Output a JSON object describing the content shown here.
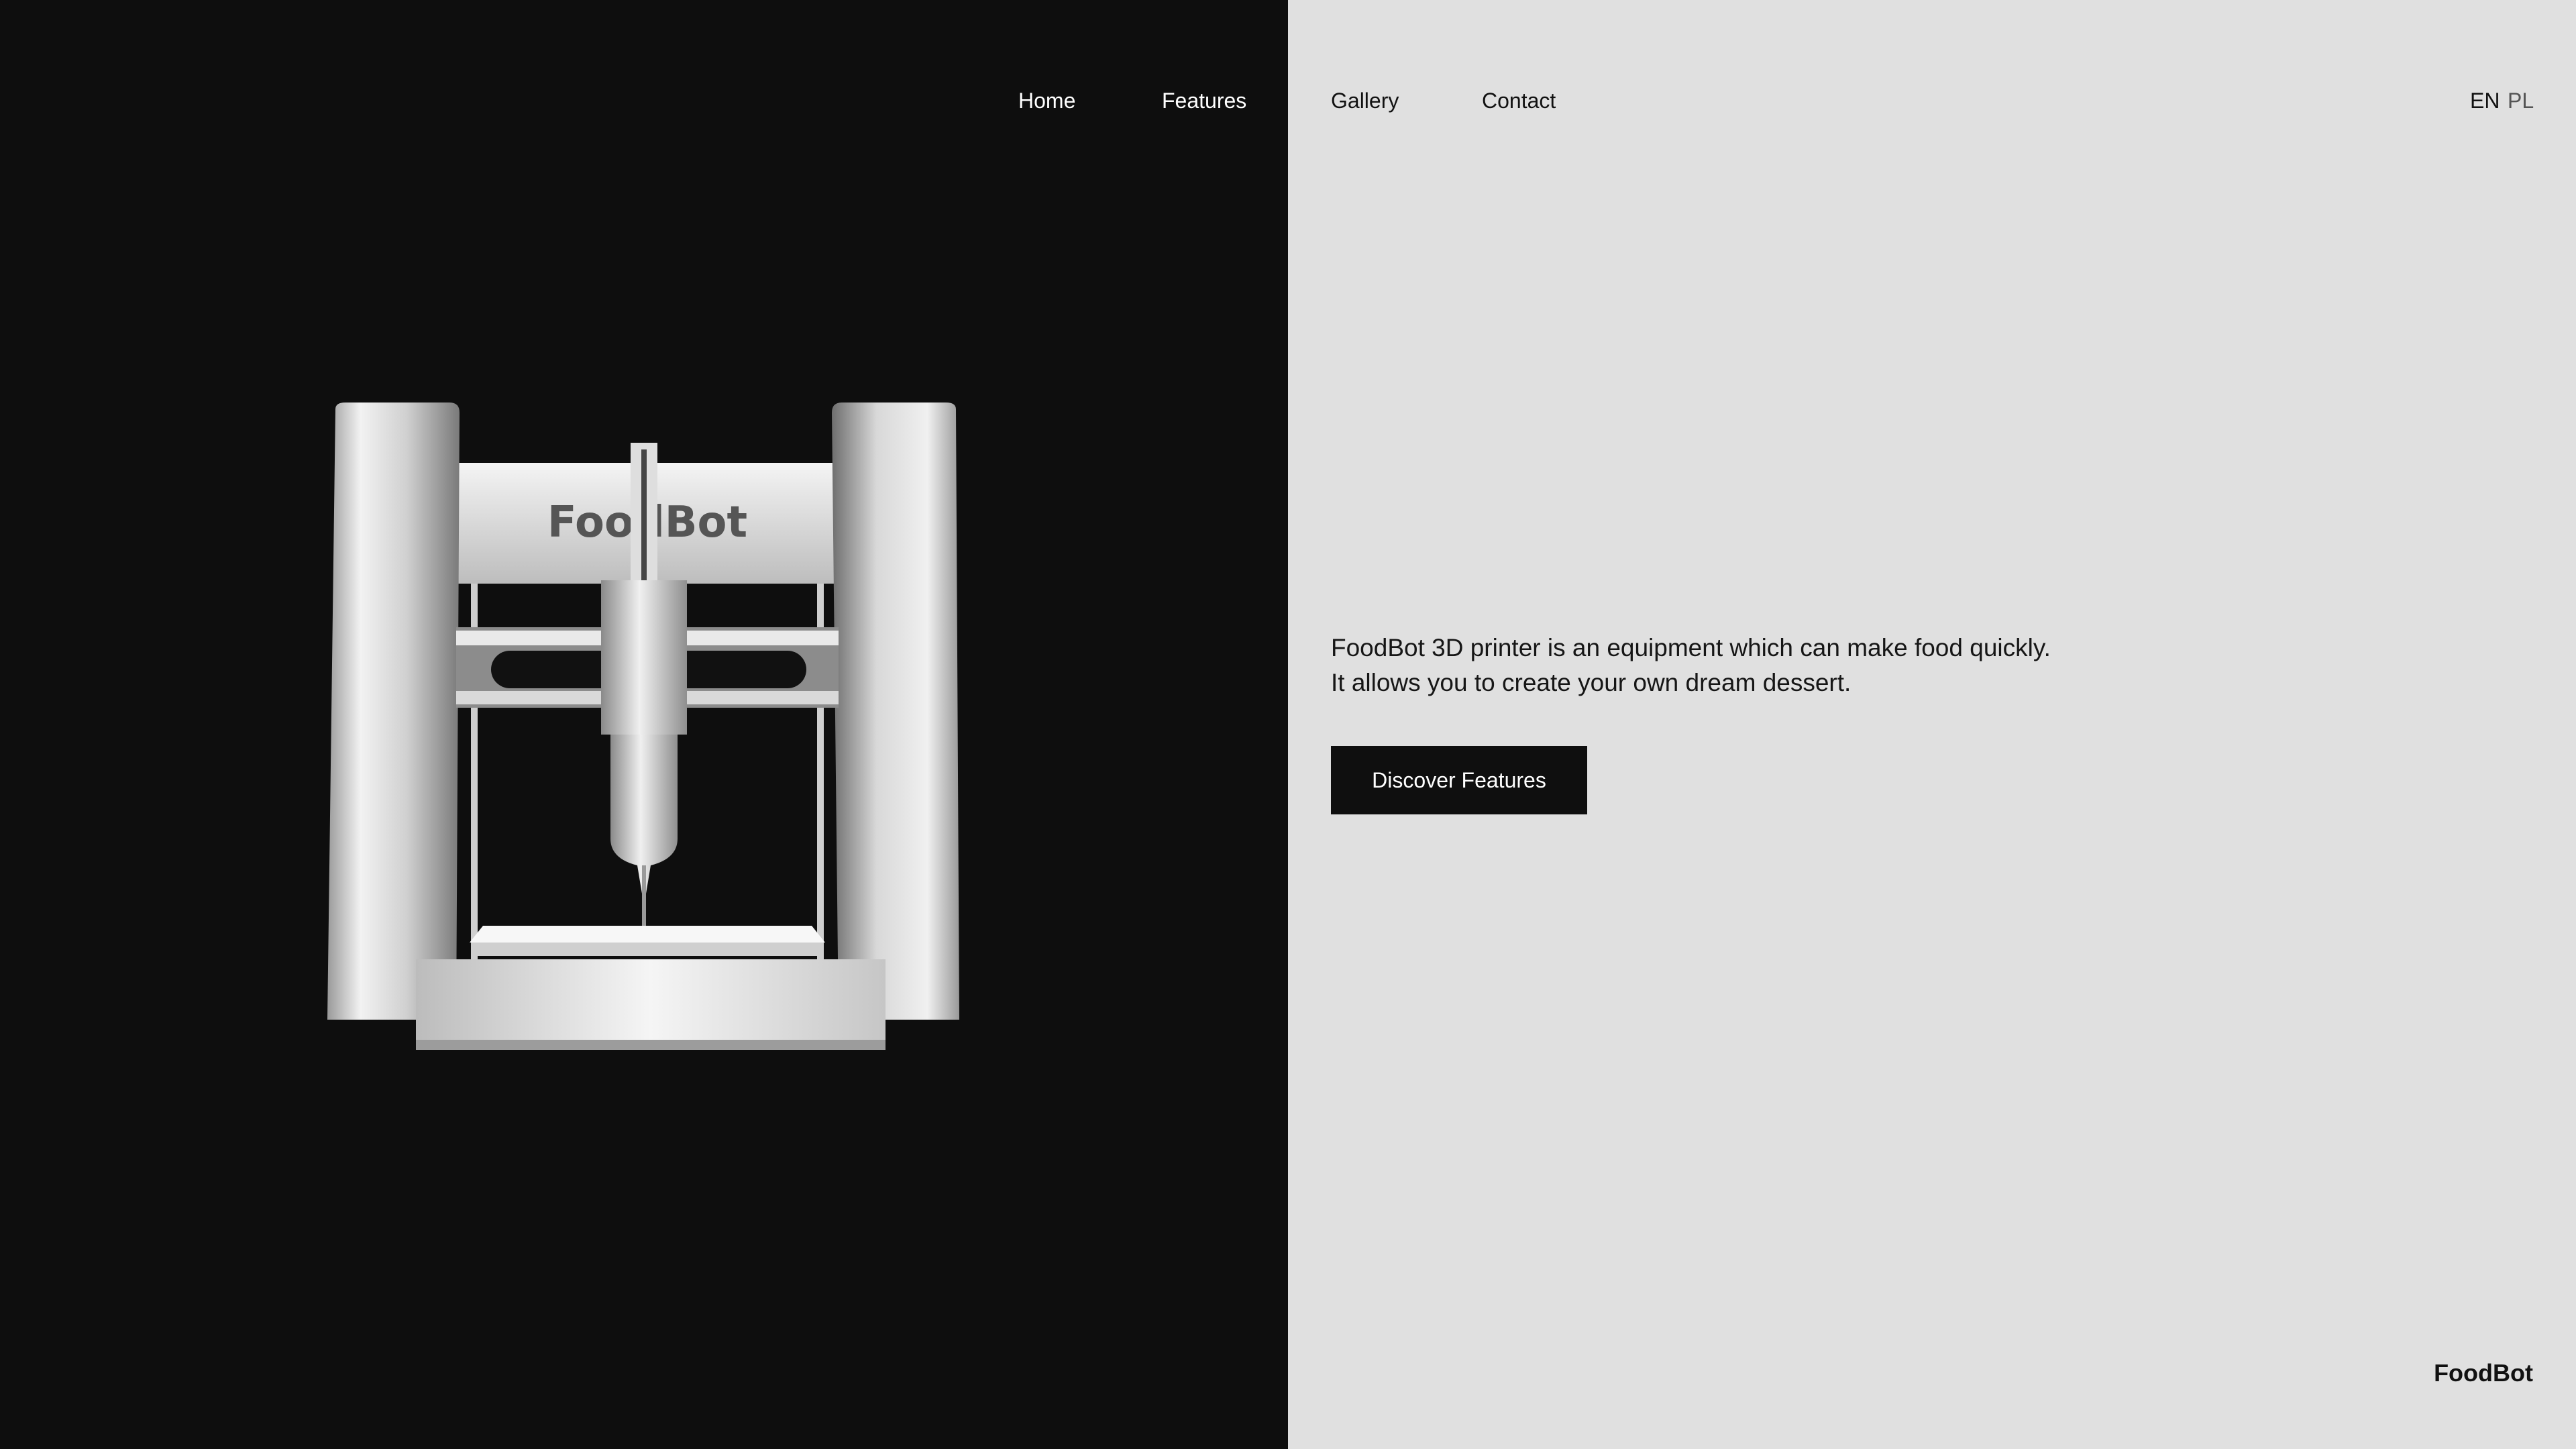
{
  "nav": {
    "items": [
      {
        "label": "Home"
      },
      {
        "label": "Features"
      },
      {
        "label": "Gallery"
      },
      {
        "label": "Contact"
      }
    ]
  },
  "language": {
    "options": [
      "EN",
      "PL"
    ],
    "active": "EN"
  },
  "hero": {
    "line1": "FoodBot 3D printer is an equipment which can make food quickly.",
    "line2": "It allows you to create your own dream dessert.",
    "cta_label": "Discover Features",
    "product_name": "FoodBot"
  },
  "footer": {
    "brand": "FoodBot"
  },
  "colors": {
    "dark_panel": "#0e0e0e",
    "light_panel": "#e0e0e0",
    "button": "#0f0f0f"
  }
}
